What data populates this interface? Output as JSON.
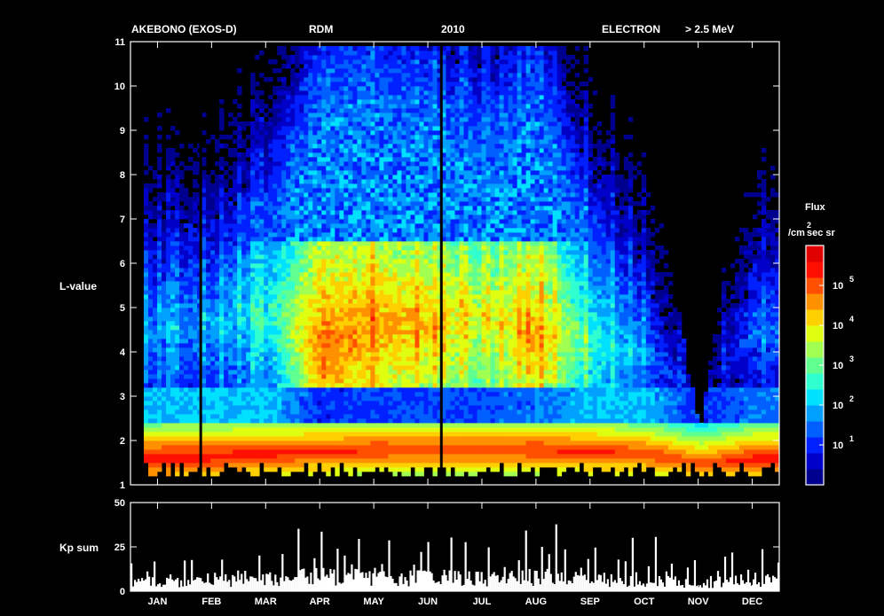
{
  "header": {
    "mission": "AKEBONO (EXOS-D)",
    "instrument": "RDM",
    "year": "2010",
    "particle": "ELECTRON",
    "energy": "> 2.5 MeV"
  },
  "colors": {
    "background": "#000000",
    "axes": "#ffffff",
    "colormap": [
      "#00008f",
      "#0000c8",
      "#0020ff",
      "#0060ff",
      "#00a0ff",
      "#00e0ff",
      "#30ffd0",
      "#60ff90",
      "#a0ff50",
      "#e0ff10",
      "#ffd000",
      "#ff9000",
      "#ff5000",
      "#ff1000",
      "#e00000"
    ]
  },
  "chart_data": [
    {
      "type": "heatmap",
      "title": "",
      "xlabel": "",
      "ylabel": "L-value",
      "ylim": [
        1,
        11
      ],
      "ytick_labels": [
        "1",
        "2",
        "3",
        "4",
        "5",
        "6",
        "7",
        "8",
        "9",
        "10",
        "11"
      ],
      "xtick_labels": [
        "JAN",
        "FEB",
        "MAR",
        "APR",
        "MAY",
        "JUN",
        "JUL",
        "AUG",
        "SEP",
        "OCT",
        "NOV",
        "DEC"
      ],
      "colorbar": {
        "title": "Flux",
        "units_prefix": "/cm",
        "units_sup": "2",
        "units_suffix": "sec sr",
        "scale": "log",
        "range": [
          1,
          1000000
        ],
        "tick_labels": [
          {
            "base": "10",
            "exp": "1"
          },
          {
            "base": "10",
            "exp": "2"
          },
          {
            "base": "10",
            "exp": "3"
          },
          {
            "base": "10",
            "exp": "4"
          },
          {
            "base": "10",
            "exp": "5"
          }
        ]
      },
      "columns": [
        {
          "month": "JAN",
          "inner_log": 5.6,
          "inner_L": 1.6,
          "slot_log": 2.0,
          "outer_log": 1.6,
          "outer_L": 4.5,
          "outer_top": 10.8
        },
        {
          "month": "FEB",
          "inner_log": 5.5,
          "inner_L": 1.65,
          "slot_log": 2.0,
          "outer_log": 1.8,
          "outer_L": 4.6,
          "outer_top": 10.8
        },
        {
          "month": "MAR",
          "inner_log": 5.4,
          "inner_L": 1.7,
          "slot_log": 2.1,
          "outer_log": 2.4,
          "outer_L": 5.0,
          "outer_top": 10.9
        },
        {
          "month": "APR",
          "inner_log": 5.3,
          "inner_L": 1.75,
          "slot_log": 1.0,
          "outer_log": 4.8,
          "outer_L": 4.1,
          "outer_top": 10.9
        },
        {
          "month": "MAY",
          "inner_log": 5.3,
          "inner_L": 1.8,
          "slot_log": 1.2,
          "outer_log": 4.5,
          "outer_L": 4.6,
          "outer_top": 10.9
        },
        {
          "month": "JUN",
          "inner_log": 5.2,
          "inner_L": 1.8,
          "slot_log": 1.2,
          "outer_log": 4.2,
          "outer_L": 4.6,
          "outer_top": 10.9
        },
        {
          "month": "JUL",
          "inner_log": 5.2,
          "inner_L": 1.8,
          "slot_log": 1.3,
          "outer_log": 3.6,
          "outer_L": 4.8,
          "outer_top": 10.9
        },
        {
          "month": "AUG",
          "inner_log": 5.3,
          "inner_L": 1.8,
          "slot_log": 1.5,
          "outer_log": 4.4,
          "outer_L": 4.4,
          "outer_top": 10.9
        },
        {
          "month": "SEP",
          "inner_log": 5.3,
          "inner_L": 1.75,
          "slot_log": 2.0,
          "outer_log": 2.6,
          "outer_L": 4.2,
          "outer_top": 10.9
        },
        {
          "month": "OCT",
          "inner_log": 5.2,
          "inner_L": 1.7,
          "slot_log": 2.0,
          "outer_log": 1.6,
          "outer_L": 4.0,
          "outer_top": 9.0
        },
        {
          "month": "NOV",
          "inner_log": 5.0,
          "inner_L": 1.5,
          "slot_log": 1.0,
          "outer_log": 0.0,
          "outer_L": 3.0,
          "outer_top": 2.2
        },
        {
          "month": "DEC",
          "inner_log": 5.4,
          "inner_L": 1.6,
          "slot_log": 1.5,
          "outer_log": 1.4,
          "outer_L": 4.5,
          "outer_top": 10.8
        }
      ],
      "data_gaps_month_index": [
        1.3,
        5.75
      ]
    },
    {
      "type": "bar",
      "title": "",
      "xlabel": "",
      "ylabel": "Kp sum",
      "ylim": [
        0,
        50
      ],
      "ytick_labels": [
        "0",
        "25",
        "50"
      ],
      "xtick_labels": [
        "JAN",
        "FEB",
        "MAR",
        "APR",
        "MAY",
        "JUN",
        "JUL",
        "AUG",
        "SEP",
        "OCT",
        "NOV",
        "DEC"
      ],
      "monthly_peaks": [
        {
          "month": "JAN",
          "max": 18,
          "typical": 6
        },
        {
          "month": "FEB",
          "max": 20,
          "typical": 7
        },
        {
          "month": "MAR",
          "max": 22,
          "typical": 8
        },
        {
          "month": "APR",
          "max": 39,
          "typical": 10
        },
        {
          "month": "MAY",
          "max": 30,
          "typical": 9
        },
        {
          "month": "JUN",
          "max": 32,
          "typical": 9
        },
        {
          "month": "JUL",
          "max": 28,
          "typical": 8
        },
        {
          "month": "AUG",
          "max": 38,
          "typical": 9
        },
        {
          "month": "SEP",
          "max": 26,
          "typical": 8
        },
        {
          "month": "OCT",
          "max": 31,
          "typical": 8
        },
        {
          "month": "NOV",
          "max": 20,
          "typical": 6
        },
        {
          "month": "DEC",
          "max": 24,
          "typical": 7
        }
      ]
    }
  ]
}
